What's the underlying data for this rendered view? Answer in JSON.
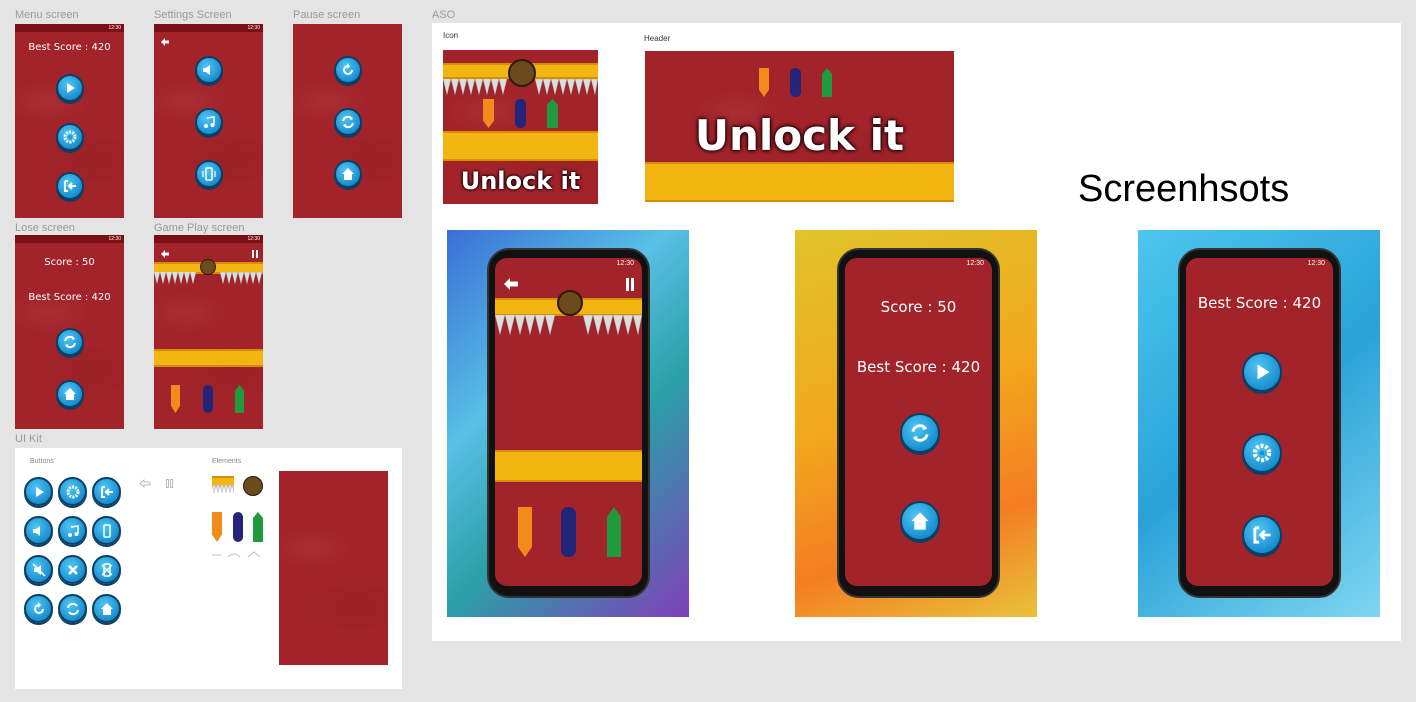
{
  "canvas": {
    "labels": {
      "menu": "Menu screen",
      "settings": "Settings Screen",
      "pause": "Pause screen",
      "lose": "Lose screen",
      "gameplay": "Game Play screen",
      "uikit": "UI Kit",
      "aso": "ASO"
    }
  },
  "status_time": "12:30",
  "menu": {
    "best_score": "Best Score : 420"
  },
  "lose": {
    "score": "Score : 50",
    "best_score": "Best Score : 420"
  },
  "uikit": {
    "buttons_label": "Buttons",
    "elements_label": "Elements"
  },
  "aso": {
    "icon_label": "Icon",
    "header_label": "Header",
    "icon_text": "Unlock it",
    "header_text": "Unlock it",
    "screenshots_title": "Screenhsots"
  },
  "shot2": {
    "score": "Score : 50",
    "best_score": "Best Score : 420"
  },
  "shot3": {
    "best_score": "Best Score : 420"
  },
  "colors": {
    "game_red": "#a3232a",
    "button_blue": "#1a8fd0",
    "bar_yellow": "#f3b512",
    "pillar_orange": "#f38a1c",
    "pillar_navy": "#23257a",
    "pillar_green": "#1f9a3c"
  }
}
